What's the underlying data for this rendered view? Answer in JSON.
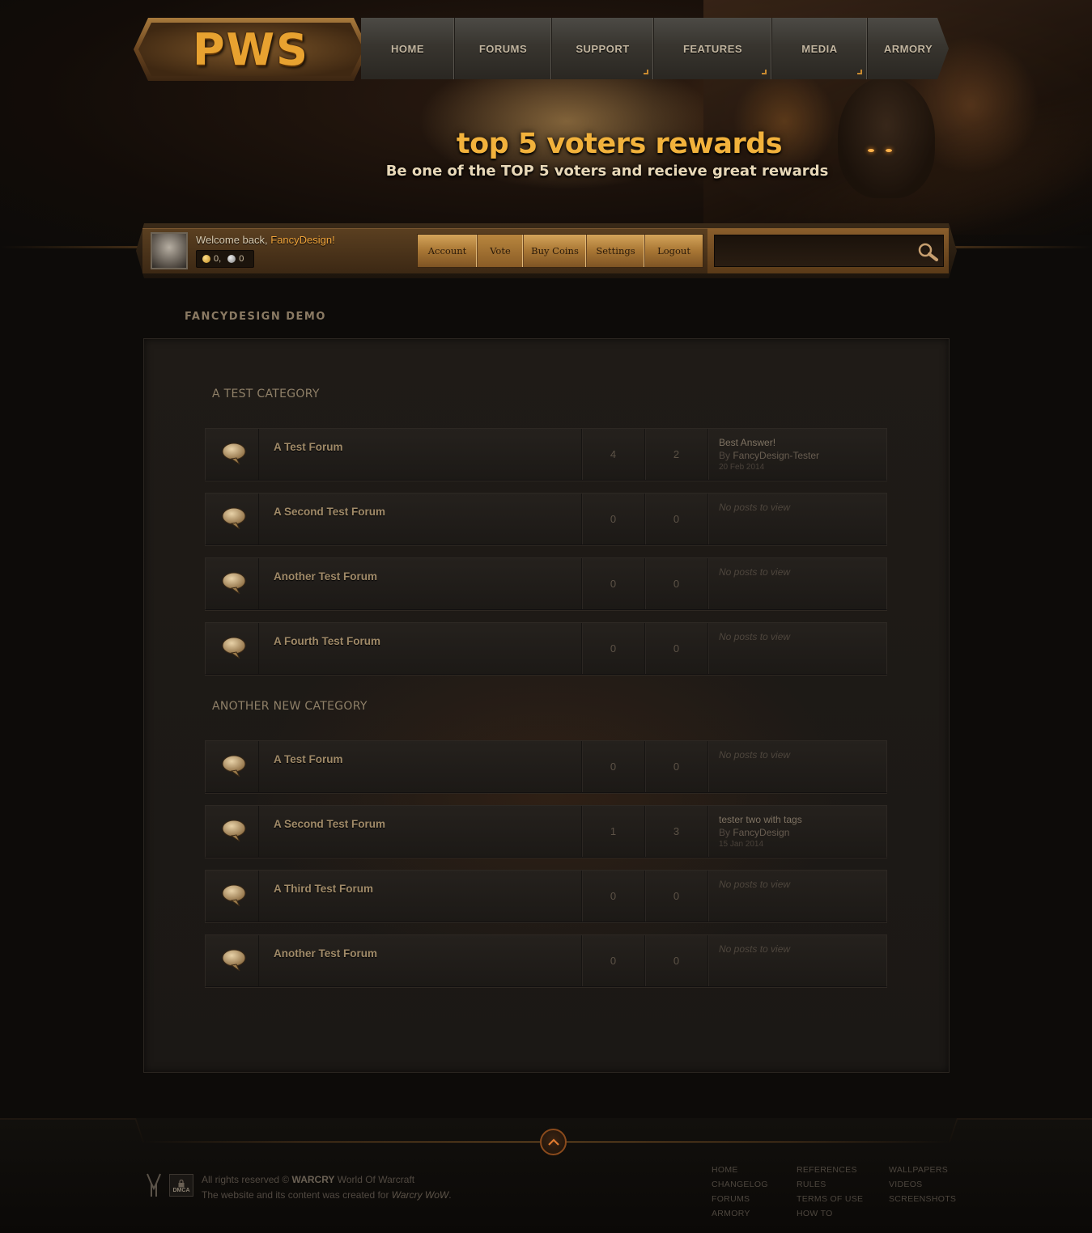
{
  "brand": {
    "logo_text": "PWS"
  },
  "topnav": [
    {
      "label": "HOME",
      "corner": false
    },
    {
      "label": "FORUMS",
      "corner": false
    },
    {
      "label": "SUPPORT",
      "corner": true
    },
    {
      "label": "FEATURES",
      "corner": true
    },
    {
      "label": "MEDIA",
      "corner": true
    },
    {
      "label": "ARMORY",
      "corner": false
    }
  ],
  "banner": {
    "title": "top 5 voters rewards",
    "subtitle": "Be one of the TOP 5 voters and recieve great rewards"
  },
  "userbar": {
    "welcome_prefix": "Welcome back, ",
    "username": "FancyDesign!",
    "gold_coins": "0,",
    "silver_coins": "0",
    "actions": [
      {
        "label": "Account",
        "active": false
      },
      {
        "label": "Vote",
        "active": true
      },
      {
        "label": "Buy Coins",
        "active": false
      },
      {
        "label": "Settings",
        "active": false
      },
      {
        "label": "Logout",
        "active": false
      }
    ],
    "search_value": "",
    "search_placeholder": ""
  },
  "main": {
    "section_title": "FANCYDESIGN DEMO",
    "categories": [
      {
        "title": "A TEST CATEGORY",
        "forums": [
          {
            "name": "A Test Forum",
            "topics": "4",
            "posts": "2",
            "last": {
              "title": "Best Answer!",
              "by": "By ",
              "author": "FancyDesign-Tester",
              "date": "20 Feb 2014"
            }
          },
          {
            "name": "A Second Test Forum",
            "topics": "0",
            "posts": "0",
            "last": {
              "empty": "No posts to view"
            }
          },
          {
            "name": "Another Test Forum",
            "topics": "0",
            "posts": "0",
            "last": {
              "empty": "No posts to view"
            }
          },
          {
            "name": "A Fourth Test Forum",
            "topics": "0",
            "posts": "0",
            "last": {
              "empty": "No posts to view"
            }
          }
        ]
      },
      {
        "title": "ANOTHER NEW CATEGORY",
        "forums": [
          {
            "name": "A Test Forum",
            "topics": "0",
            "posts": "0",
            "last": {
              "empty": "No posts to view"
            }
          },
          {
            "name": "A Second Test Forum",
            "topics": "1",
            "posts": "3",
            "last": {
              "title": "tester two with tags",
              "by": "By ",
              "author": "FancyDesign",
              "date": "15 Jan 2014"
            }
          },
          {
            "name": "A Third Test Forum",
            "topics": "0",
            "posts": "0",
            "last": {
              "empty": "No posts to view"
            }
          },
          {
            "name": "Another Test Forum",
            "topics": "0",
            "posts": "0",
            "last": {
              "empty": "No posts to view"
            }
          }
        ]
      }
    ]
  },
  "footer": {
    "dmca_label": "DMCA",
    "rights_prefix": "All rights reserved © ",
    "rights_brand": "WARCRY",
    "rights_suffix": " World Of Warcraft",
    "created_prefix": "The website and its content was created for ",
    "created_brand": "Warcry WoW",
    "created_suffix": ".",
    "columns": [
      [
        "HOME",
        "CHANGELOG",
        "FORUMS",
        "ARMORY"
      ],
      [
        "REFERENCES",
        "RULES",
        "TERMS OF USE",
        "HOW TO"
      ],
      [
        "WALLPAPERS",
        "VIDEOS",
        "SCREENSHOTS"
      ]
    ]
  },
  "colors": {
    "accent_gold": "#f0a43a",
    "background": "#0d0b09",
    "panel": "#1f1b17"
  },
  "icons": [
    "search-icon",
    "speech-bubble-icon",
    "gold-coin-icon",
    "silver-coin-icon",
    "chevron-up-icon",
    "warcry-logo-icon"
  ]
}
